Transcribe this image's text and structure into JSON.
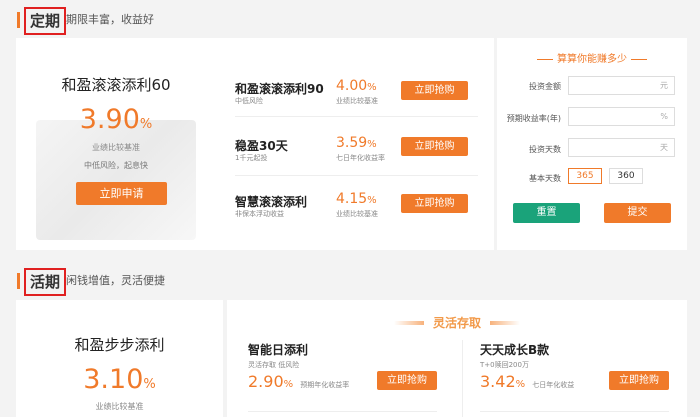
{
  "fixed": {
    "title": "定期",
    "subtitle": "期限丰富，收益好",
    "featured": {
      "name": "和盈滚滚添利60",
      "rate": "3.90",
      "rate_unit": "%",
      "rate_label": "业绩比较基准",
      "risk_note": "中低风险，起息快",
      "button": "立即申请"
    },
    "products": [
      {
        "name": "和盈滚滚添利90",
        "sub": "中低风险",
        "rate": "4.00",
        "unit": "%",
        "rate_label": "业绩比较基准",
        "button": "立即抢购"
      },
      {
        "name": "稳盈30天",
        "sub": "1千元起投",
        "rate": "3.59",
        "unit": "%",
        "rate_label": "七日年化收益率",
        "button": "立即抢购"
      },
      {
        "name": "智慧滚滚添利",
        "sub": "非保本浮动收益",
        "rate": "4.15",
        "unit": "%",
        "rate_label": "业绩比较基准",
        "button": "立即抢购"
      }
    ]
  },
  "calculator": {
    "title": "算算你能赚多少",
    "fields": [
      {
        "label": "投资金额",
        "unit": "元"
      },
      {
        "label": "预期收益率(年)",
        "unit": "%"
      },
      {
        "label": "投资天数",
        "unit": "天"
      }
    ],
    "base_days_label": "基本天数",
    "base_days_options": [
      "365",
      "360"
    ],
    "reset": "重置",
    "submit": "提交"
  },
  "current": {
    "title": "活期",
    "subtitle": "闲钱增值，灵活便捷",
    "featured": {
      "name": "和盈步步添利",
      "rate": "3.10",
      "rate_unit": "%",
      "rate_label": "业绩比较基准"
    },
    "banner": "灵活存取",
    "products": [
      {
        "name": "智能日添利",
        "sub": "灵活存取  低风险",
        "rate": "2.90",
        "unit": "%",
        "rate_label": "预期年化收益率",
        "button": "立即抢购"
      },
      {
        "name": "天天成长B款",
        "sub": "T+0赎回200万",
        "rate": "3.42",
        "unit": "%",
        "rate_label": "七日年化收益",
        "button": "立即抢购"
      }
    ]
  },
  "colors": {
    "accent": "#f07a2a",
    "reset_green": "#1aa37a",
    "highlight_red": "#e02020"
  }
}
